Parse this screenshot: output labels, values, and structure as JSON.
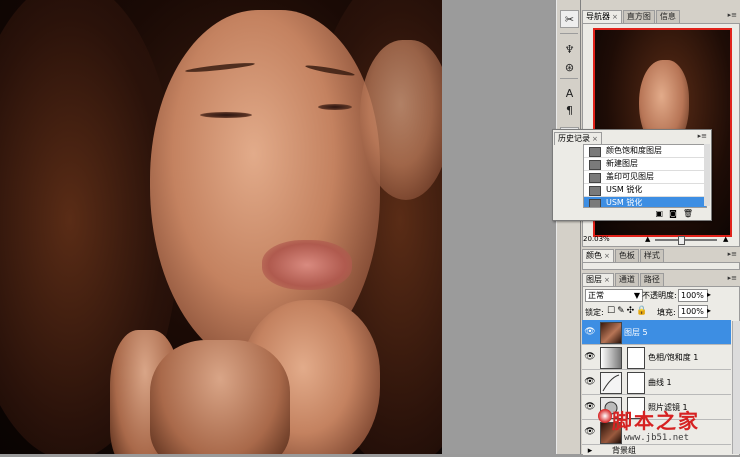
{
  "navigator": {
    "tabs": [
      "导航器",
      "直方图",
      "信息"
    ],
    "zoom": "20.03%"
  },
  "history": {
    "tab": "历史记录",
    "items": [
      {
        "label": "颜色饱和度图层"
      },
      {
        "label": "新建图层"
      },
      {
        "label": "盖印可见图层"
      },
      {
        "label": "USM 锐化"
      },
      {
        "label": "USM 锐化",
        "selected": true
      }
    ]
  },
  "color_panel": {
    "tabs": [
      "颜色",
      "色板",
      "样式"
    ]
  },
  "layers": {
    "tabs": [
      "图层",
      "通道",
      "路径"
    ],
    "blend_mode": "正常",
    "opacity_label": "不透明度:",
    "opacity_value": "100%",
    "lock_label": "锁定:",
    "fill_label": "填充:",
    "fill_value": "100%",
    "rows": [
      {
        "name": "图层 5",
        "selected": true,
        "has_mask": false
      },
      {
        "name": "色相/饱和度 1",
        "selected": false,
        "has_mask": true
      },
      {
        "name": "曲线 1",
        "selected": false,
        "has_mask": true
      },
      {
        "name": "照片滤镜 1",
        "selected": false,
        "has_mask": true
      },
      {
        "name": "背景组",
        "selected": false,
        "has_mask": false
      }
    ]
  },
  "watermark": {
    "text": "脚本之家",
    "url": "www.jb51.net"
  },
  "colors": {
    "panel_bg": "#d4d0c8",
    "selection": "#3d8ee3",
    "nav_frame": "#e0221a",
    "watermark_red": "#d62222"
  }
}
